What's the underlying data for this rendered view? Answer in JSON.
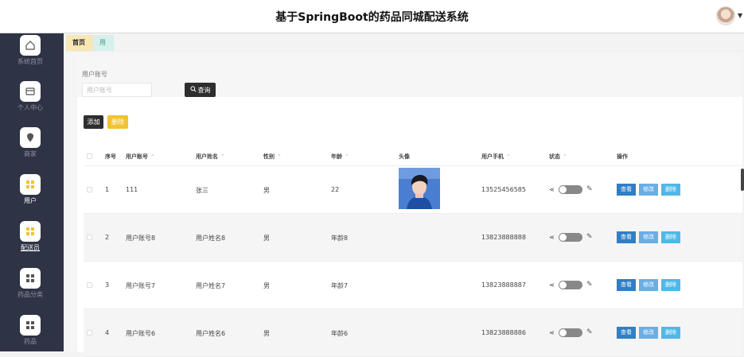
{
  "app": {
    "title": "基于SpringBoot的药品同城配送系统"
  },
  "sidebar": {
    "items": [
      {
        "label": "系统首页",
        "icon": "home-icon"
      },
      {
        "label": "个人中心",
        "icon": "card-icon"
      },
      {
        "label": "商家",
        "icon": "location-pin-icon"
      },
      {
        "label": "用户",
        "icon": "grid-icon",
        "active": true
      },
      {
        "label": "配送员",
        "icon": "grid-icon"
      },
      {
        "label": "药品分类",
        "icon": "grid-icon"
      },
      {
        "label": "药品",
        "icon": "grid-icon"
      }
    ]
  },
  "tabs": {
    "home": "首页",
    "user": "用户"
  },
  "search": {
    "label": "用户账号",
    "placeholder": "用户账号",
    "button": "查询"
  },
  "actions": {
    "add": "添加",
    "delete": "删除"
  },
  "table": {
    "headers": {
      "index": "序号",
      "account": "用户账号",
      "name": "用户姓名",
      "gender": "性别",
      "age": "年龄",
      "avatar": "头像",
      "phone": "用户手机",
      "status": "状态",
      "operations": "操作"
    },
    "rows": [
      {
        "index": "1",
        "account": "111",
        "name": "张三",
        "gender": "男",
        "age": "22",
        "phone": "13525456585",
        "has_avatar": true
      },
      {
        "index": "2",
        "account": "用户账号8",
        "name": "用户姓名8",
        "gender": "男",
        "age": "年龄8",
        "phone": "13823888888",
        "has_avatar": false
      },
      {
        "index": "3",
        "account": "用户账号7",
        "name": "用户姓名7",
        "gender": "男",
        "age": "年龄7",
        "phone": "13823888887",
        "has_avatar": false
      },
      {
        "index": "4",
        "account": "用户账号6",
        "name": "用户姓名6",
        "gender": "男",
        "age": "年龄6",
        "phone": "13823888886",
        "has_avatar": false
      }
    ],
    "row_ops": {
      "view": "查看",
      "modify": "修改",
      "remove": "删除"
    }
  },
  "colors": {
    "sidebar": "#2f3346",
    "accent_yellow": "#f1c232",
    "view_btn": "#2f7fc6",
    "modify_btn": "#6aaee5",
    "remove_btn": "#4fb8e8"
  }
}
